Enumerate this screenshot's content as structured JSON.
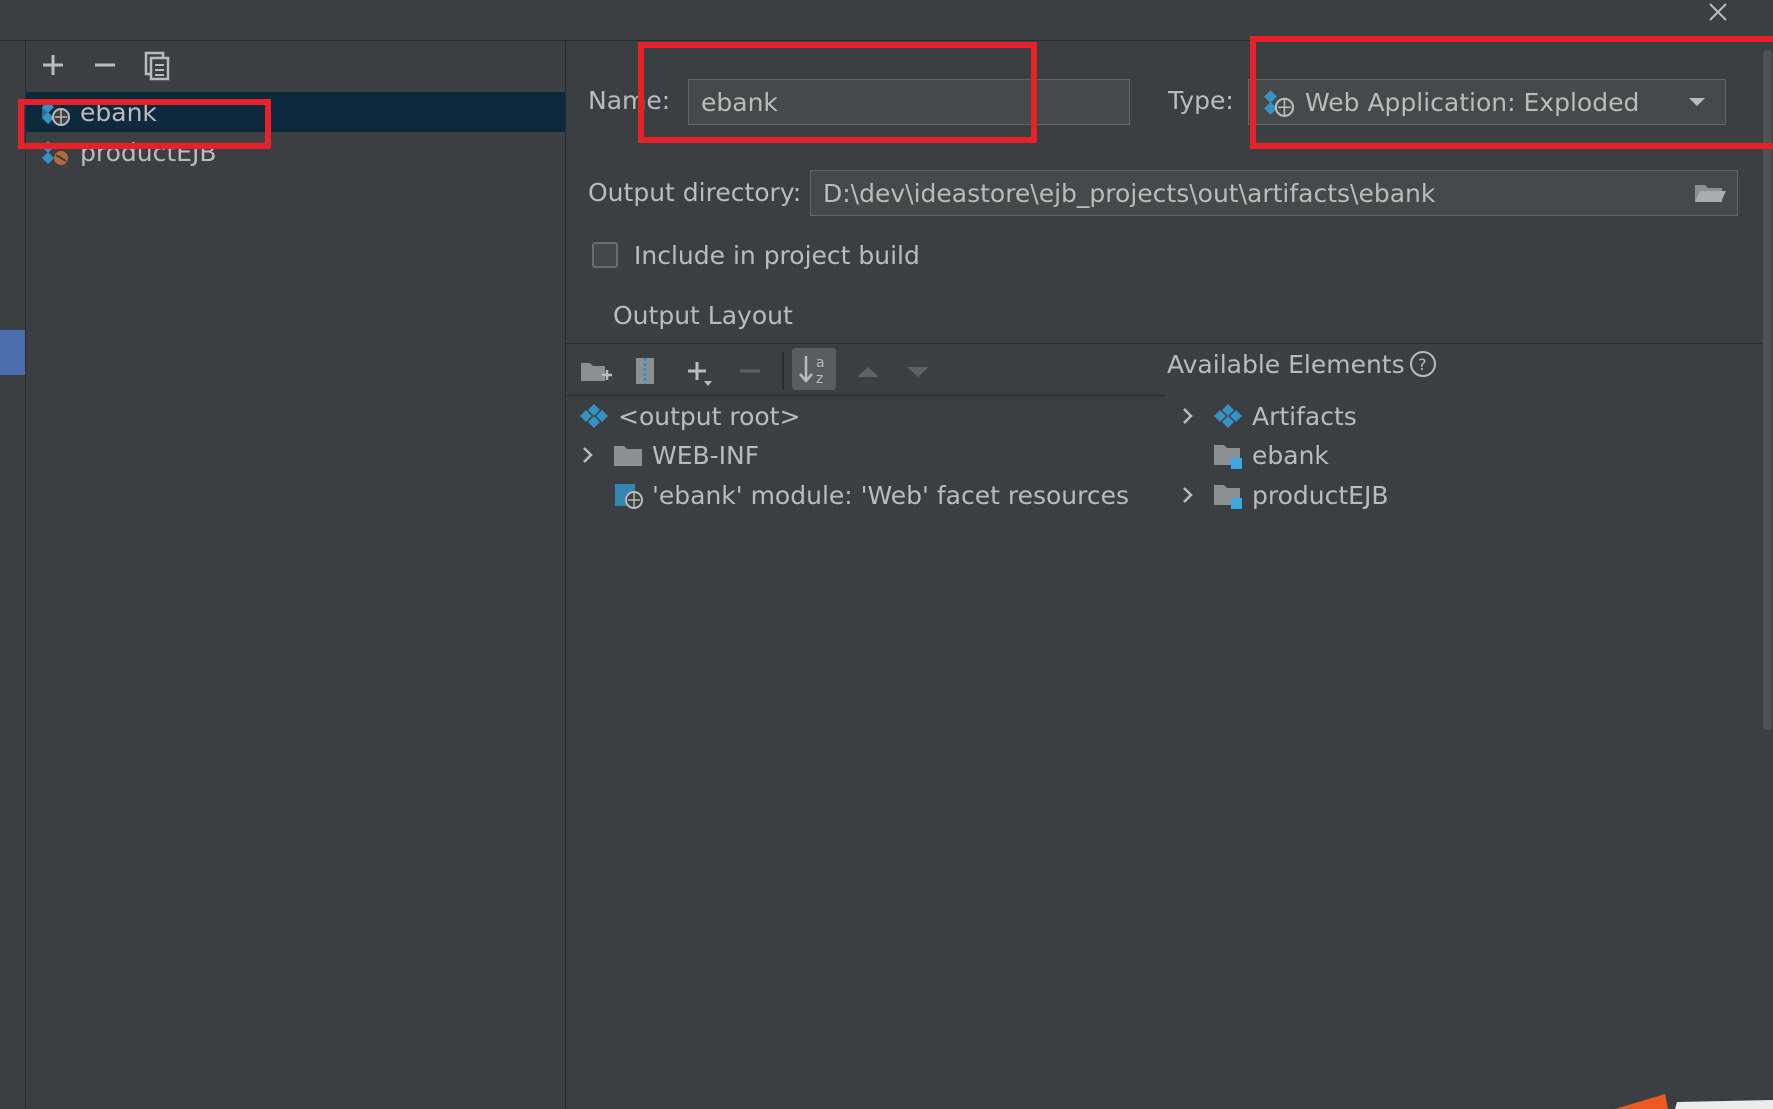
{
  "artifacts_list": {
    "toolbar": {
      "add_icon": "plus-icon",
      "remove_icon": "minus-icon",
      "copy_icon": "copy-icon"
    },
    "items": [
      {
        "label": "ebank",
        "icon": "web-exploded-artifact-icon",
        "selected": true
      },
      {
        "label": "productEJB",
        "icon": "ejb-exploded-artifact-icon",
        "selected": false
      }
    ]
  },
  "form": {
    "name_label": "Name:",
    "name_value": "ebank",
    "type_label": "Type:",
    "type_value": "Web Application: Exploded",
    "output_dir_label": "Output directory:",
    "output_dir_value": "D:\\dev\\ideastore\\ejb_projects\\out\\artifacts\\ebank",
    "include_build_label": "Include in project build",
    "include_build_checked": false
  },
  "output_layout": {
    "title": "Output Layout",
    "tree": [
      {
        "label": "<output root>",
        "icon": "artifact-root-icon",
        "expandable": false
      },
      {
        "label": "WEB-INF",
        "icon": "folder-icon",
        "expandable": true
      },
      {
        "label": "'ebank' module: 'Web' facet resources",
        "icon": "web-facet-icon",
        "expandable": false
      }
    ]
  },
  "available_elements": {
    "title": "Available Elements",
    "tree": [
      {
        "label": "Artifacts",
        "icon": "artifacts-icon",
        "expandable": true
      },
      {
        "label": "ebank",
        "icon": "module-folder-icon",
        "expandable": false
      },
      {
        "label": "productEJB",
        "icon": "module-folder-icon",
        "expandable": true
      }
    ]
  },
  "colors": {
    "background": "#3c3f41",
    "selection": "#0d293e",
    "field_background": "#45494a",
    "annotation_red": "#e8202a",
    "icon_blue": "#3592c4"
  }
}
